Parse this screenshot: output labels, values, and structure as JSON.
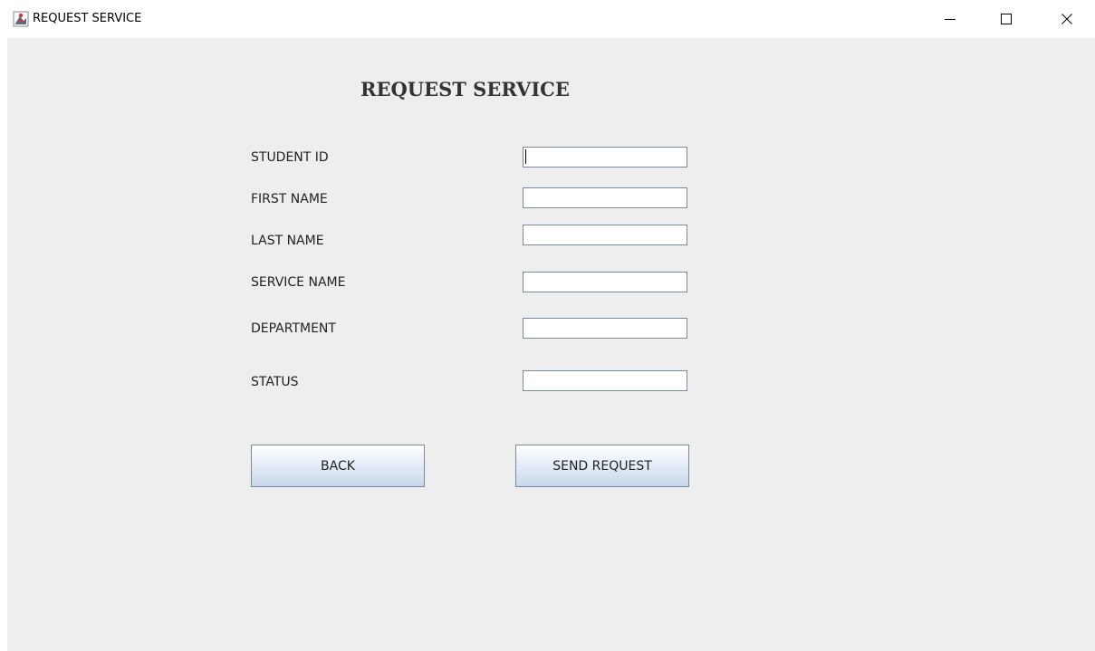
{
  "window": {
    "title": "REQUEST SERVICE",
    "app_icon": "java-cup-icon",
    "controls": {
      "minimize": "minimize-icon",
      "maximize": "maximize-icon",
      "close": "close-icon"
    }
  },
  "form": {
    "heading": "REQUEST SERVICE",
    "fields": [
      {
        "label": "STUDENT ID",
        "value": ""
      },
      {
        "label": "FIRST NAME",
        "value": ""
      },
      {
        "label": "LAST NAME",
        "value": ""
      },
      {
        "label": "SERVICE NAME",
        "value": ""
      },
      {
        "label": "DEPARTMENT",
        "value": ""
      },
      {
        "label": "STATUS",
        "value": ""
      }
    ],
    "buttons": {
      "back": "BACK",
      "send": "SEND REQUEST"
    }
  },
  "colors": {
    "panel_background": "#eeeeee",
    "button_gradient_top": "#ffffff",
    "button_gradient_bottom": "#c8d8ea",
    "input_border": "#7a8a99"
  }
}
